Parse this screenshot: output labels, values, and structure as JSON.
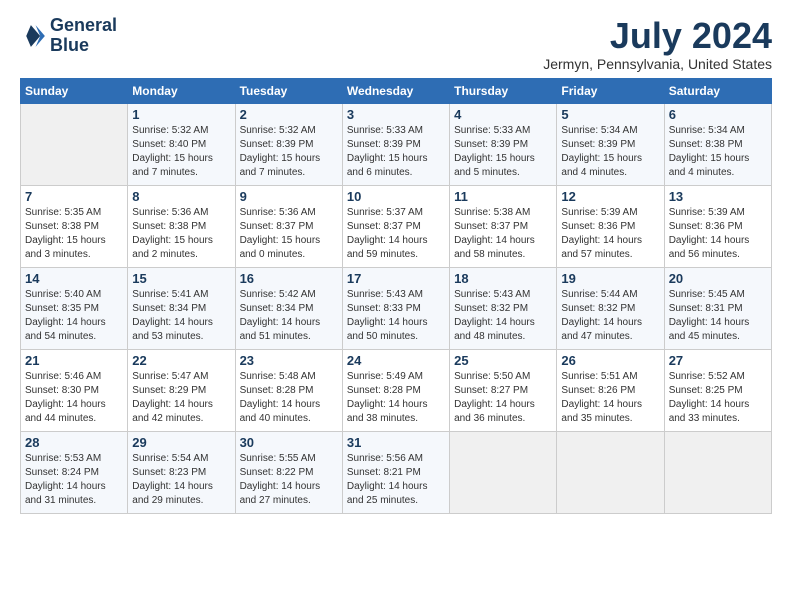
{
  "header": {
    "logo_line1": "General",
    "logo_line2": "Blue",
    "month_year": "July 2024",
    "location": "Jermyn, Pennsylvania, United States"
  },
  "days_of_week": [
    "Sunday",
    "Monday",
    "Tuesday",
    "Wednesday",
    "Thursday",
    "Friday",
    "Saturday"
  ],
  "weeks": [
    [
      {
        "day": "",
        "sunrise": "",
        "sunset": "",
        "daylight": ""
      },
      {
        "day": "1",
        "sunrise": "Sunrise: 5:32 AM",
        "sunset": "Sunset: 8:40 PM",
        "daylight": "Daylight: 15 hours and 7 minutes."
      },
      {
        "day": "2",
        "sunrise": "Sunrise: 5:32 AM",
        "sunset": "Sunset: 8:39 PM",
        "daylight": "Daylight: 15 hours and 7 minutes."
      },
      {
        "day": "3",
        "sunrise": "Sunrise: 5:33 AM",
        "sunset": "Sunset: 8:39 PM",
        "daylight": "Daylight: 15 hours and 6 minutes."
      },
      {
        "day": "4",
        "sunrise": "Sunrise: 5:33 AM",
        "sunset": "Sunset: 8:39 PM",
        "daylight": "Daylight: 15 hours and 5 minutes."
      },
      {
        "day": "5",
        "sunrise": "Sunrise: 5:34 AM",
        "sunset": "Sunset: 8:39 PM",
        "daylight": "Daylight: 15 hours and 4 minutes."
      },
      {
        "day": "6",
        "sunrise": "Sunrise: 5:34 AM",
        "sunset": "Sunset: 8:38 PM",
        "daylight": "Daylight: 15 hours and 4 minutes."
      }
    ],
    [
      {
        "day": "7",
        "sunrise": "Sunrise: 5:35 AM",
        "sunset": "Sunset: 8:38 PM",
        "daylight": "Daylight: 15 hours and 3 minutes."
      },
      {
        "day": "8",
        "sunrise": "Sunrise: 5:36 AM",
        "sunset": "Sunset: 8:38 PM",
        "daylight": "Daylight: 15 hours and 2 minutes."
      },
      {
        "day": "9",
        "sunrise": "Sunrise: 5:36 AM",
        "sunset": "Sunset: 8:37 PM",
        "daylight": "Daylight: 15 hours and 0 minutes."
      },
      {
        "day": "10",
        "sunrise": "Sunrise: 5:37 AM",
        "sunset": "Sunset: 8:37 PM",
        "daylight": "Daylight: 14 hours and 59 minutes."
      },
      {
        "day": "11",
        "sunrise": "Sunrise: 5:38 AM",
        "sunset": "Sunset: 8:37 PM",
        "daylight": "Daylight: 14 hours and 58 minutes."
      },
      {
        "day": "12",
        "sunrise": "Sunrise: 5:39 AM",
        "sunset": "Sunset: 8:36 PM",
        "daylight": "Daylight: 14 hours and 57 minutes."
      },
      {
        "day": "13",
        "sunrise": "Sunrise: 5:39 AM",
        "sunset": "Sunset: 8:36 PM",
        "daylight": "Daylight: 14 hours and 56 minutes."
      }
    ],
    [
      {
        "day": "14",
        "sunrise": "Sunrise: 5:40 AM",
        "sunset": "Sunset: 8:35 PM",
        "daylight": "Daylight: 14 hours and 54 minutes."
      },
      {
        "day": "15",
        "sunrise": "Sunrise: 5:41 AM",
        "sunset": "Sunset: 8:34 PM",
        "daylight": "Daylight: 14 hours and 53 minutes."
      },
      {
        "day": "16",
        "sunrise": "Sunrise: 5:42 AM",
        "sunset": "Sunset: 8:34 PM",
        "daylight": "Daylight: 14 hours and 51 minutes."
      },
      {
        "day": "17",
        "sunrise": "Sunrise: 5:43 AM",
        "sunset": "Sunset: 8:33 PM",
        "daylight": "Daylight: 14 hours and 50 minutes."
      },
      {
        "day": "18",
        "sunrise": "Sunrise: 5:43 AM",
        "sunset": "Sunset: 8:32 PM",
        "daylight": "Daylight: 14 hours and 48 minutes."
      },
      {
        "day": "19",
        "sunrise": "Sunrise: 5:44 AM",
        "sunset": "Sunset: 8:32 PM",
        "daylight": "Daylight: 14 hours and 47 minutes."
      },
      {
        "day": "20",
        "sunrise": "Sunrise: 5:45 AM",
        "sunset": "Sunset: 8:31 PM",
        "daylight": "Daylight: 14 hours and 45 minutes."
      }
    ],
    [
      {
        "day": "21",
        "sunrise": "Sunrise: 5:46 AM",
        "sunset": "Sunset: 8:30 PM",
        "daylight": "Daylight: 14 hours and 44 minutes."
      },
      {
        "day": "22",
        "sunrise": "Sunrise: 5:47 AM",
        "sunset": "Sunset: 8:29 PM",
        "daylight": "Daylight: 14 hours and 42 minutes."
      },
      {
        "day": "23",
        "sunrise": "Sunrise: 5:48 AM",
        "sunset": "Sunset: 8:28 PM",
        "daylight": "Daylight: 14 hours and 40 minutes."
      },
      {
        "day": "24",
        "sunrise": "Sunrise: 5:49 AM",
        "sunset": "Sunset: 8:28 PM",
        "daylight": "Daylight: 14 hours and 38 minutes."
      },
      {
        "day": "25",
        "sunrise": "Sunrise: 5:50 AM",
        "sunset": "Sunset: 8:27 PM",
        "daylight": "Daylight: 14 hours and 36 minutes."
      },
      {
        "day": "26",
        "sunrise": "Sunrise: 5:51 AM",
        "sunset": "Sunset: 8:26 PM",
        "daylight": "Daylight: 14 hours and 35 minutes."
      },
      {
        "day": "27",
        "sunrise": "Sunrise: 5:52 AM",
        "sunset": "Sunset: 8:25 PM",
        "daylight": "Daylight: 14 hours and 33 minutes."
      }
    ],
    [
      {
        "day": "28",
        "sunrise": "Sunrise: 5:53 AM",
        "sunset": "Sunset: 8:24 PM",
        "daylight": "Daylight: 14 hours and 31 minutes."
      },
      {
        "day": "29",
        "sunrise": "Sunrise: 5:54 AM",
        "sunset": "Sunset: 8:23 PM",
        "daylight": "Daylight: 14 hours and 29 minutes."
      },
      {
        "day": "30",
        "sunrise": "Sunrise: 5:55 AM",
        "sunset": "Sunset: 8:22 PM",
        "daylight": "Daylight: 14 hours and 27 minutes."
      },
      {
        "day": "31",
        "sunrise": "Sunrise: 5:56 AM",
        "sunset": "Sunset: 8:21 PM",
        "daylight": "Daylight: 14 hours and 25 minutes."
      },
      {
        "day": "",
        "sunrise": "",
        "sunset": "",
        "daylight": ""
      },
      {
        "day": "",
        "sunrise": "",
        "sunset": "",
        "daylight": ""
      },
      {
        "day": "",
        "sunrise": "",
        "sunset": "",
        "daylight": ""
      }
    ]
  ]
}
